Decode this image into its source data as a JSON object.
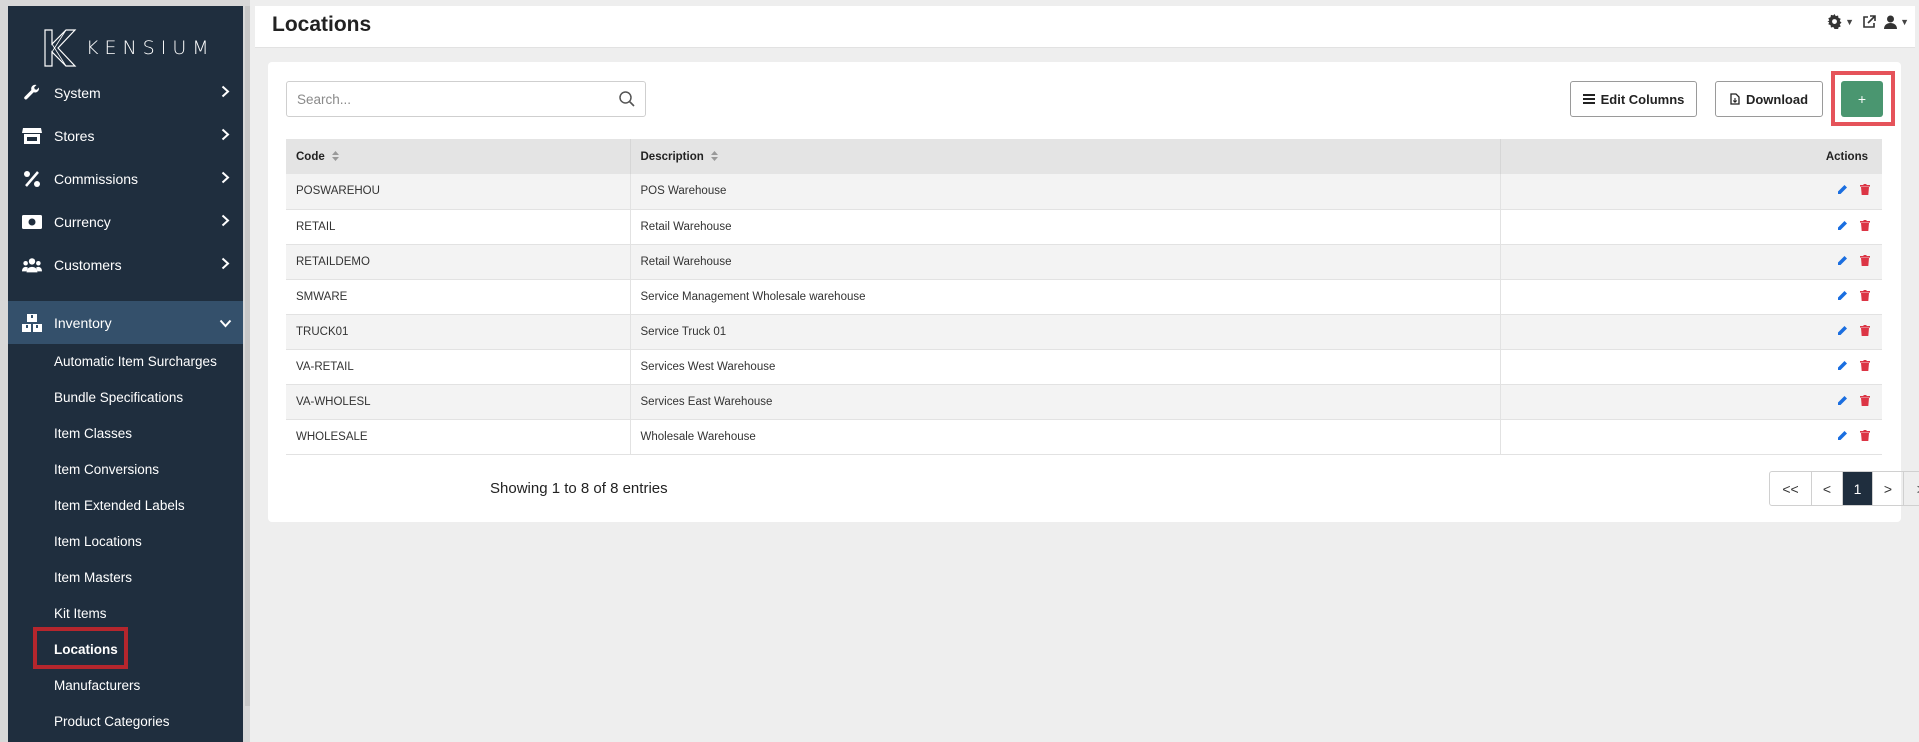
{
  "app": {
    "logo_text": "KENSIUM"
  },
  "sidebar": {
    "items": [
      {
        "label": "System",
        "icon": "wrench-icon"
      },
      {
        "label": "Stores",
        "icon": "store-icon"
      },
      {
        "label": "Commissions",
        "icon": "percent-icon"
      },
      {
        "label": "Currency",
        "icon": "money-icon"
      },
      {
        "label": "Customers",
        "icon": "users-icon"
      },
      {
        "label": "Inventory",
        "icon": "boxes-icon",
        "expanded": true
      }
    ],
    "sub_items": [
      "Automatic Item Surcharges",
      "Bundle Specifications",
      "Item Classes",
      "Item Conversions",
      "Item Extended Labels",
      "Item Locations",
      "Item Masters",
      "Kit Items",
      "Locations",
      "Manufacturers",
      "Product Categories"
    ],
    "current_sub_item": "Locations"
  },
  "header": {
    "title": "Locations"
  },
  "toolbar": {
    "search_placeholder": "Search...",
    "edit_columns_label": "Edit Columns",
    "download_label": "Download",
    "add_label": "+"
  },
  "table": {
    "columns": [
      "Code",
      "Description",
      "Actions"
    ],
    "rows": [
      {
        "code": "POSWAREHOU",
        "description": "POS Warehouse"
      },
      {
        "code": "RETAIL",
        "description": "Retail Warehouse"
      },
      {
        "code": "RETAILDEMO",
        "description": "Retail Warehouse"
      },
      {
        "code": "SMWARE",
        "description": "Service Management Wholesale warehouse"
      },
      {
        "code": "TRUCK01",
        "description": "Service Truck 01"
      },
      {
        "code": "VA-RETAIL",
        "description": "Services West Warehouse"
      },
      {
        "code": "VA-WHOLESL",
        "description": "Services East Warehouse"
      },
      {
        "code": "WHOLESALE",
        "description": "Wholesale Warehouse"
      }
    ]
  },
  "footer": {
    "info": "Showing 1 to 8 of 8 entries",
    "pager": {
      "first": "<<",
      "prev": "<",
      "current": "1",
      "next": ">",
      "last": ">>"
    }
  },
  "colors": {
    "sidebar": "#1f2e3e",
    "sidebar_active": "#34506b",
    "add_button": "#4a9670",
    "edit_icon": "#1a6ee0",
    "delete_icon": "#dc3545",
    "highlight": "#b5262d"
  }
}
